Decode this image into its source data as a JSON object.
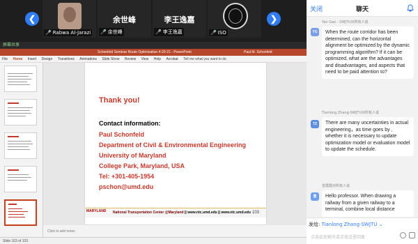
{
  "gallery": {
    "prev_arrow": "❮",
    "next_arrow": "❯",
    "participants": [
      {
        "name": "",
        "label": "Rabwa Al-Jarazi"
      },
      {
        "name": "余世峰",
        "label": "余世峰"
      },
      {
        "name": "李王逸嘉",
        "label": "李王逸嘉"
      },
      {
        "name": "",
        "label": "ISO"
      }
    ]
  },
  "ppt": {
    "share_label": "屏幕共享",
    "window_title": "Schonfeld Seminar Route Optimization 4-20-21 - PowerPoint",
    "user_name": "Paul M. Schonfeld",
    "menu": [
      "File",
      "Home",
      "Insert",
      "Design",
      "Transitions",
      "Animations",
      "Slide Show",
      "Review",
      "View",
      "Help",
      "Acrobat"
    ],
    "tell_me": "Tell me what you want to do",
    "notes_placeholder": "Click to add notes",
    "status": "Slide 103 of 103",
    "thumb_numbers": [
      "99",
      "100",
      "101",
      "102",
      "103"
    ]
  },
  "slide": {
    "thank_you": "Thank you!",
    "contact_heading": "Contact information:",
    "contact_lines": [
      "Paul Schonfeld",
      "Department of Civil & Environmental Engineering",
      "University of Maryland",
      "College Park, Maryland, USA",
      "Tel: +301-405-1954",
      "pschon@umd.edu"
    ],
    "logo": "MARYLAND",
    "footer_center": "National Transportation Center @Maryland",
    "footer_url1": "www.ntc.umd.edu",
    "footer_url2": "www.ntc.umd.edu",
    "page_number": "103"
  },
  "chat": {
    "close_label": "关闭",
    "title": "聊天",
    "messages": [
      {
        "avatar": "YG",
        "avatar_color": "#7b9ee8",
        "sender": "Yan Gao - SWJTU对所有人说",
        "text": "When the route corridor has been determined, can the horizontal alignment be optimized by the dynamic programming algorithm? If it can be optimized, what are the advantages and disadvantages, and aspects that need to be paid attention to?"
      },
      {
        "avatar": "TZ",
        "avatar_color": "#5c8fe0",
        "sender": "Tianlong Zhang-SWJTU对所有人说",
        "text": "There are many uncertainties in actual engineering，as time goes by , whether it is necessary to update optimization model or evaluation model to update the schedule."
      },
      {
        "avatar": "曾",
        "avatar_color": "#6fa0f0",
        "sender": "曾霞霞对所有人说",
        "text": "Hello professor. When drawing a railway from a given railway to a terminal, combine local distance"
      }
    ],
    "send_to_label": "发给:",
    "send_to_target": "Tianlong Zhang-SWJTU",
    "input_placeholder": "点击此处聊天或点击这里回复"
  }
}
